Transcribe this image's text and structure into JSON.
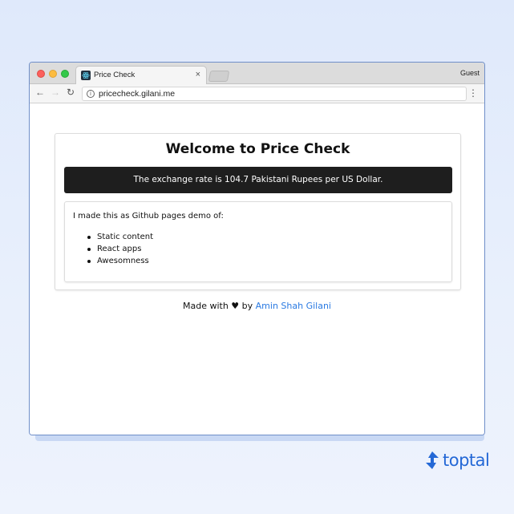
{
  "browser": {
    "tab_title": "Price Check",
    "tab_close": "×",
    "profile": "Guest",
    "url": "pricecheck.gilani.me",
    "back": "←",
    "forward": "→",
    "reload": "↻",
    "menu": "⋮",
    "info": "i"
  },
  "page": {
    "heading": "Welcome to Price Check",
    "exchange_message": "The exchange rate is 104.7 Pakistani Rupees per US Dollar.",
    "intro": "I made this as Github pages demo of:",
    "features": [
      "Static content",
      "React apps",
      "Awesomness"
    ],
    "footer_prefix": "Made with ♥ by",
    "footer_link": "Amin Shah Gilani"
  },
  "brand": {
    "name": "toptal",
    "color": "#2468d6"
  },
  "colors": {
    "banner_bg": "#1e1e1e",
    "link": "#2a7ae2",
    "window_border": "#6f8fc9"
  }
}
